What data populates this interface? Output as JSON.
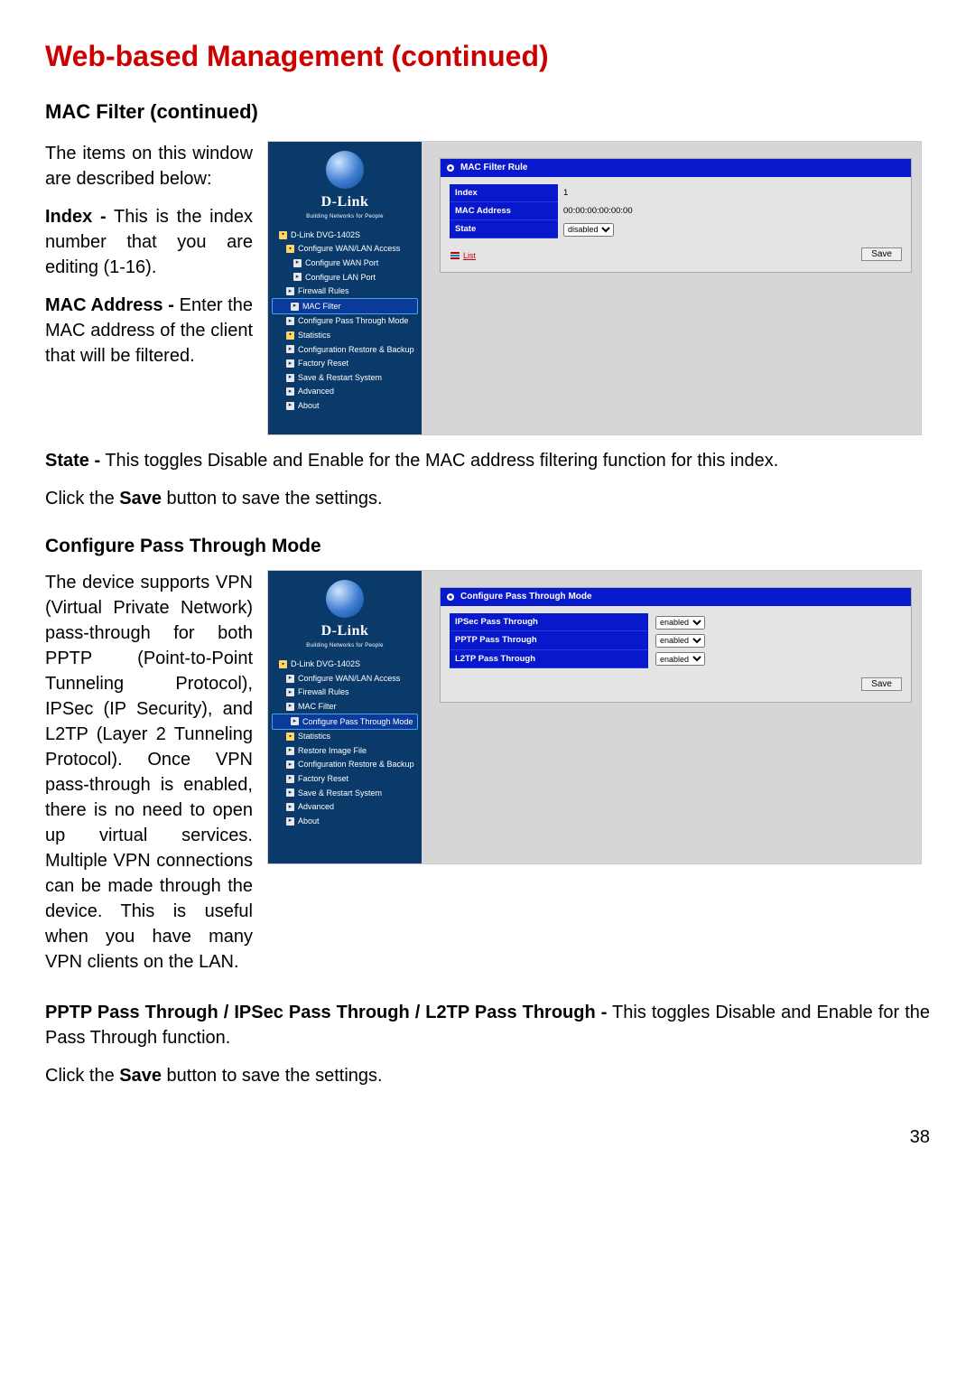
{
  "page": {
    "title": "Web-based Management (continued)",
    "section1": "MAC Filter (continued)",
    "section2": "Configure Pass Through Mode",
    "page_number": "38"
  },
  "text": {
    "intro1": "The items on this window are described below:",
    "index_label": "Index -",
    "index_body": " This is the index number that you are editing (1-16).",
    "mac_label": "MAC Address -",
    "mac_body": " Enter the MAC address of the client that will be filtered.",
    "state_label": "State -",
    "state_body": " This toggles Disable and Enable for the MAC address filtering function for this index.",
    "save_sentence_1a": "Click the ",
    "save_word": "Save",
    "save_sentence_1b": " button to save the settings.",
    "pt_body": "The device supports VPN (Virtual Private Network) pass-through for both PPTP (Point-to-Point Tunneling Protocol), IPSec (IP Security), and L2TP (Layer 2 Tunneling Protocol). Once VPN pass-through is enabled, there is no need to open up virtual services. Multiple VPN connections can be made through the device. This is useful when you have many VPN clients on the LAN.",
    "pt_label": "PPTP Pass Through / IPSec Pass Through / L2TP Pass Through -",
    "pt_label_body": " This toggles Disable and Enable for the Pass Through function.",
    "save_sentence_2a": "Click the ",
    "save_sentence_2b": " button to save the settings."
  },
  "shared": {
    "brand": "D-Link",
    "brand_tag": "Building Networks for People",
    "device": "D-Link DVG-1402S",
    "save_btn": "Save",
    "list_link": "List"
  },
  "shot1": {
    "panel_title": "MAC Filter Rule",
    "nav": [
      {
        "t": "D-Link DVG-1402S",
        "cls": "",
        "ico": "folder"
      },
      {
        "t": "Configure WAN/LAN Access",
        "cls": "indent1",
        "ico": "folder"
      },
      {
        "t": "Configure WAN Port",
        "cls": "indent2",
        "ico": "doc"
      },
      {
        "t": "Configure LAN Port",
        "cls": "indent2",
        "ico": "doc"
      },
      {
        "t": "Firewall Rules",
        "cls": "indent1",
        "ico": "doc"
      },
      {
        "t": "MAC Filter",
        "cls": "indent1 selected",
        "ico": "doc"
      },
      {
        "t": "Configure Pass Through Mode",
        "cls": "indent1",
        "ico": "doc"
      },
      {
        "t": "Statistics",
        "cls": "indent1",
        "ico": "folder"
      },
      {
        "t": "Configuration Restore & Backup",
        "cls": "indent1",
        "ico": "doc"
      },
      {
        "t": "Factory Reset",
        "cls": "indent1",
        "ico": "doc"
      },
      {
        "t": "Save & Restart System",
        "cls": "indent1",
        "ico": "doc"
      },
      {
        "t": "Advanced",
        "cls": "indent1",
        "ico": "doc"
      },
      {
        "t": "About",
        "cls": "indent1",
        "ico": "doc"
      }
    ],
    "fields": {
      "index_lbl": "Index",
      "index_val": "1",
      "mac_lbl": "MAC Address",
      "mac_val": "00:00:00:00:00:00",
      "state_lbl": "State",
      "state_val": "disabled"
    }
  },
  "shot2": {
    "panel_title": "Configure Pass Through Mode",
    "nav": [
      {
        "t": "D-Link DVG-1402S",
        "cls": "",
        "ico": "folder"
      },
      {
        "t": "Configure WAN/LAN Access",
        "cls": "indent1",
        "ico": "doc"
      },
      {
        "t": "Firewall Rules",
        "cls": "indent1",
        "ico": "doc"
      },
      {
        "t": "MAC Filter",
        "cls": "indent1",
        "ico": "doc"
      },
      {
        "t": "Configure Pass Through Mode",
        "cls": "indent1 selected",
        "ico": "doc"
      },
      {
        "t": "Statistics",
        "cls": "indent1",
        "ico": "folder"
      },
      {
        "t": "Restore Image File",
        "cls": "indent1",
        "ico": "doc"
      },
      {
        "t": "Configuration Restore & Backup",
        "cls": "indent1",
        "ico": "doc"
      },
      {
        "t": "Factory Reset",
        "cls": "indent1",
        "ico": "doc"
      },
      {
        "t": "Save & Restart System",
        "cls": "indent1",
        "ico": "doc"
      },
      {
        "t": "Advanced",
        "cls": "indent1",
        "ico": "doc"
      },
      {
        "t": "About",
        "cls": "indent1",
        "ico": "doc"
      }
    ],
    "fields": {
      "ipsec_lbl": "IPSec Pass Through",
      "pptp_lbl": "PPTP Pass Through",
      "l2tp_lbl": "L2TP Pass Through",
      "val": "enabled"
    }
  }
}
